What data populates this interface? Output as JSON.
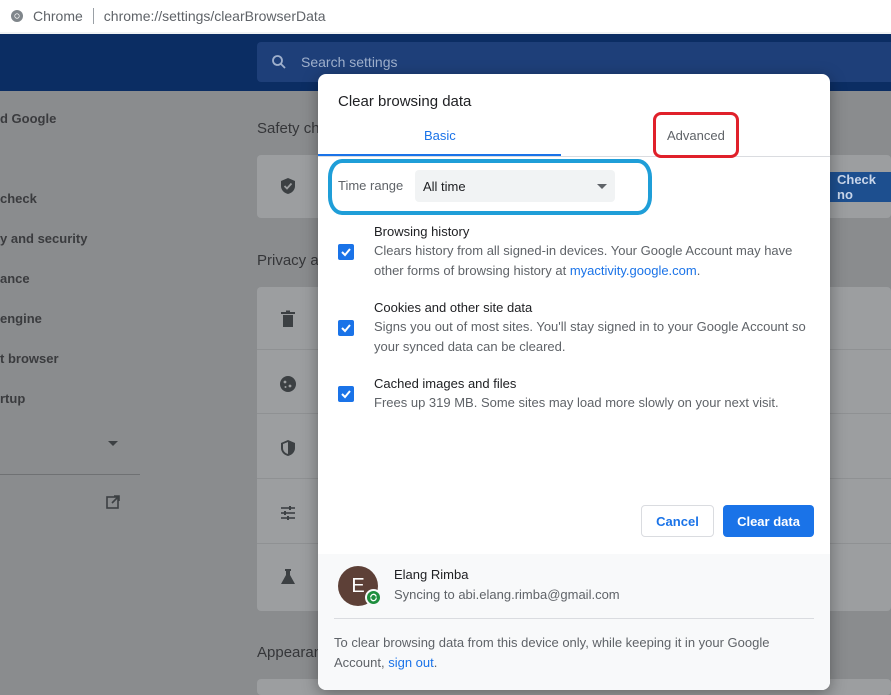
{
  "browser": {
    "app_name": "Chrome",
    "url": "chrome://settings/clearBrowserData"
  },
  "settings": {
    "search_placeholder": "Search settings",
    "sidebar_items": [
      "d Google",
      "check",
      "y and security",
      "ance",
      " engine",
      "t browser",
      "rtup"
    ],
    "sections": [
      "Safety ch",
      "Privacy ar",
      "Appearan"
    ],
    "check_now_label": "Check no"
  },
  "dialog": {
    "title": "Clear browsing data",
    "tabs": [
      {
        "label": "Basic",
        "selected": true
      },
      {
        "label": "Advanced",
        "selected": false
      }
    ],
    "time_range": {
      "label": "Time range",
      "value": "All time"
    },
    "items": [
      {
        "title": "Browsing history",
        "desc_before_link": "Clears history from all signed-in devices. Your Google Account may have other forms of browsing history at ",
        "link": "myactivity.google.com",
        "desc_after_link": ".",
        "checked": true
      },
      {
        "title": "Cookies and other site data",
        "desc": "Signs you out of most sites. You'll stay signed in to your Google Account so your synced data can be cleared.",
        "checked": true
      },
      {
        "title": "Cached images and files",
        "desc": "Frees up 319 MB. Some sites may load more slowly on your next visit.",
        "checked": true
      }
    ],
    "cancel_label": "Cancel",
    "clear_label": "Clear data",
    "account": {
      "initial": "E",
      "name": "Elang Rimba",
      "sync_text": "Syncing to abi.elang.rimba@gmail.com"
    },
    "footer": {
      "text": "To clear browsing data from this device only, while keeping it in your Google Account, ",
      "link": "sign out",
      "end": "."
    }
  },
  "colors": {
    "accent": "#1a73e8",
    "highlight_red": "#e0202a",
    "highlight_blue": "#1f9ed8",
    "avatar_bg": "#5d4037",
    "sync_badge": "#1e8e3e"
  }
}
